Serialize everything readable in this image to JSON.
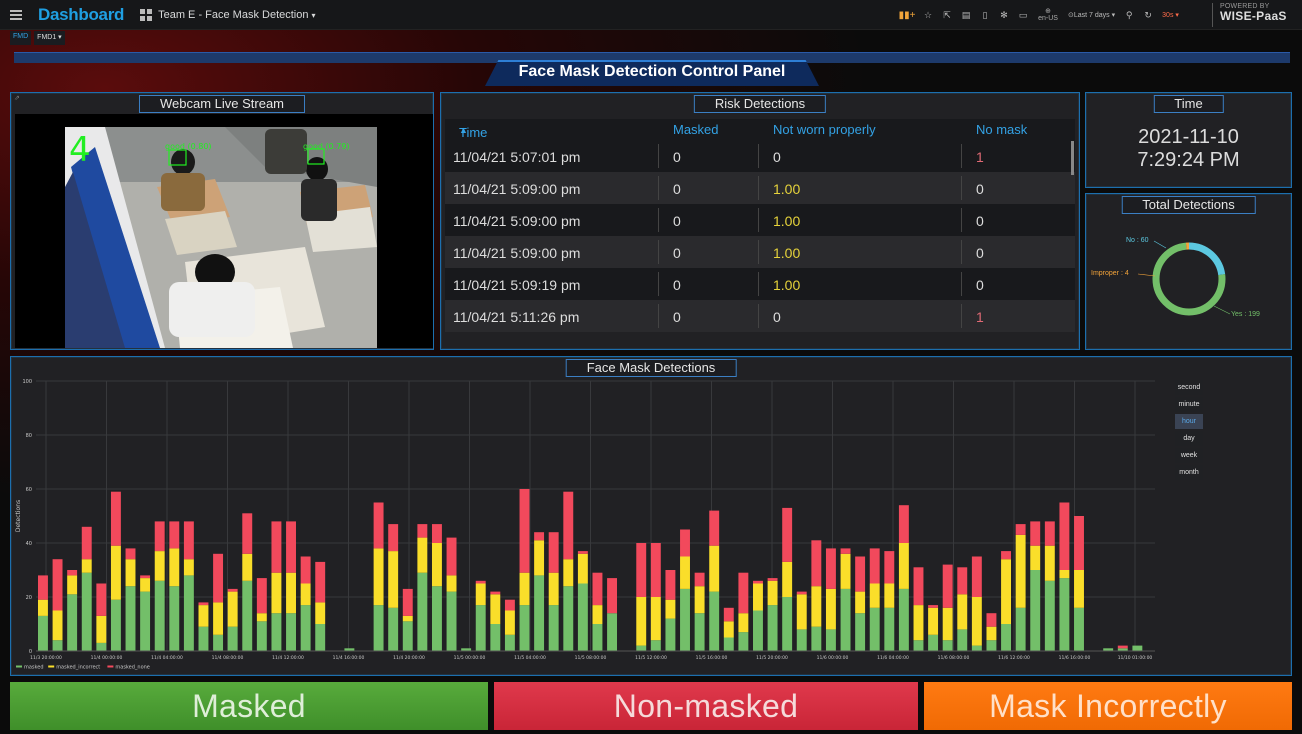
{
  "topbar": {
    "brand": "Dashboard",
    "dashboard_title": "Team E - Face Mask Detection",
    "language": "en-US",
    "time_range": "Last 7 days",
    "refresh_interval": "30s",
    "powered_by": "POWERED BY",
    "powered_brand": "WISE-PaaS"
  },
  "subbar": {
    "tag": "FMD",
    "selector": "FMD1"
  },
  "main_title": "Face Mask Detection Control Panel",
  "webcam": {
    "title": "Webcam Live Stream",
    "overlay_count": "4",
    "detection_label_1": "good (0.80)",
    "detection_label_2": "good (0.79)"
  },
  "risk": {
    "title": "Risk Detections",
    "columns": [
      "Time",
      "Masked",
      "Not worn properly",
      "No mask"
    ],
    "rows": [
      [
        "11/04/21 5:07:01 pm",
        "0",
        "0",
        "1"
      ],
      [
        "11/04/21 5:09:00 pm",
        "0",
        "1.00",
        "0"
      ],
      [
        "11/04/21 5:09:00 pm",
        "0",
        "1.00",
        "0"
      ],
      [
        "11/04/21 5:09:00 pm",
        "0",
        "1.00",
        "0"
      ],
      [
        "11/04/21 5:09:19 pm",
        "0",
        "1.00",
        "0"
      ],
      [
        "11/04/21 5:11:26 pm",
        "0",
        "0",
        "1"
      ]
    ]
  },
  "time_panel": {
    "title": "Time",
    "date": "2021-11-10",
    "time": "7:29:24 PM"
  },
  "totals": {
    "title": "Total Detections",
    "label_no": "No : 60",
    "label_improper": "Improper : 4",
    "label_yes": "Yes : 199",
    "slices": [
      {
        "name": "Yes",
        "value": 199,
        "color": "#73bf69"
      },
      {
        "name": "No",
        "value": 60,
        "color": "#5cc8e0"
      },
      {
        "name": "Improper",
        "value": 4,
        "color": "#f2a33a"
      }
    ]
  },
  "detections_chart": {
    "title": "Face Mask Detections",
    "intervals": [
      "second",
      "minute",
      "hour",
      "day",
      "week",
      "month"
    ],
    "active_interval": "hour"
  },
  "chart_data": {
    "type": "bar",
    "stacked": true,
    "title": "Face Mask Detections",
    "ylabel": "Detections",
    "ylim": [
      0,
      100
    ],
    "yticks": [
      0,
      20,
      40,
      60,
      80,
      100
    ],
    "xticks": [
      "11/3 20:00:00",
      "11/4 00:00:00",
      "11/4 04:00:00",
      "11/4 08:00:00",
      "11/4 12:00:00",
      "11/4 16:00:00",
      "11/4 20:00:00",
      "11/5 00:00:00",
      "11/5 04:00:00",
      "11/5 08:00:00",
      "11/5 12:00:00",
      "11/5 16:00:00",
      "11/5 20:00:00",
      "11/6 00:00:00",
      "11/6 04:00:00",
      "11/6 08:00:00",
      "11/6 12:00:00",
      "11/6 16:00:00",
      "11/10 01:00:00"
    ],
    "legend": [
      "masked",
      "masked_incorrect",
      "masked_none"
    ],
    "legend_position": "bottom-left",
    "grid": true,
    "colors": {
      "masked": "#73bf69",
      "masked_incorrect": "#fade2a",
      "masked_none": "#f2495c"
    },
    "series": [
      {
        "name": "masked",
        "values": [
          13,
          4,
          21,
          29,
          3,
          19,
          24,
          22,
          26,
          24,
          28,
          9,
          6,
          9,
          26,
          11,
          14,
          14,
          17,
          10,
          0,
          1,
          0,
          17,
          16,
          11,
          29,
          24,
          22,
          1,
          17,
          10,
          6,
          17,
          28,
          17,
          24,
          25,
          10,
          14,
          0,
          2,
          4,
          12,
          23,
          14,
          22,
          5,
          7,
          15,
          17,
          20,
          8,
          9,
          8,
          23,
          14,
          16,
          16,
          23,
          4,
          6,
          4,
          8,
          2,
          4,
          10,
          16,
          30,
          26,
          27,
          16,
          0,
          1,
          1,
          2
        ]
      },
      {
        "name": "masked_incorrect",
        "values": [
          6,
          11,
          7,
          5,
          10,
          20,
          10,
          5,
          11,
          14,
          6,
          8,
          12,
          13,
          10,
          3,
          15,
          15,
          8,
          8,
          0,
          0,
          0,
          21,
          21,
          2,
          13,
          16,
          6,
          0,
          8,
          11,
          9,
          12,
          13,
          12,
          10,
          11,
          7,
          0,
          0,
          18,
          16,
          7,
          12,
          10,
          17,
          6,
          7,
          10,
          9,
          13,
          13,
          15,
          15,
          13,
          8,
          9,
          9,
          17,
          13,
          10,
          12,
          13,
          18,
          5,
          24,
          27,
          9,
          13,
          3,
          14,
          0,
          0,
          0,
          0
        ]
      },
      {
        "name": "masked_none",
        "values": [
          9,
          19,
          2,
          12,
          12,
          20,
          4,
          1,
          11,
          10,
          14,
          1,
          18,
          1,
          15,
          13,
          19,
          19,
          10,
          15,
          0,
          0,
          0,
          17,
          10,
          10,
          5,
          7,
          14,
          0,
          1,
          1,
          4,
          31,
          3,
          15,
          25,
          1,
          12,
          13,
          0,
          20,
          20,
          11,
          10,
          5,
          13,
          5,
          15,
          1,
          1,
          20,
          1,
          17,
          15,
          2,
          13,
          13,
          12,
          14,
          14,
          1,
          16,
          10,
          15,
          5,
          3,
          4,
          9,
          9,
          25,
          20,
          0,
          0,
          1,
          0
        ]
      }
    ]
  },
  "footer": {
    "masked": "Masked",
    "non_masked": "Non-masked",
    "incorrect": "Mask Incorrectly"
  }
}
